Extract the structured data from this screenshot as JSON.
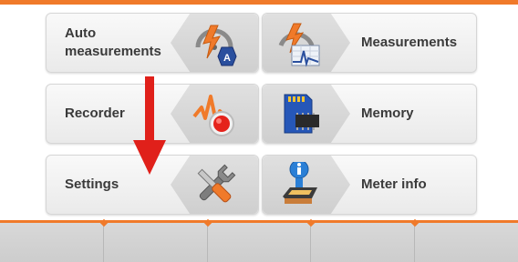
{
  "colors": {
    "accent": "#f07a2a",
    "arrow": "#e0201a"
  },
  "menu": {
    "auto_measurements": {
      "label_line1": "Auto",
      "label_line2": "measurements",
      "icon": "auto-measurements-icon"
    },
    "measurements": {
      "label": "Measurements",
      "icon": "measurements-icon"
    },
    "recorder": {
      "label": "Recorder",
      "icon": "recorder-icon"
    },
    "memory": {
      "label": "Memory",
      "icon": "memory-card-icon"
    },
    "settings": {
      "label": "Settings",
      "icon": "settings-tools-icon"
    },
    "meter_info": {
      "label": "Meter info",
      "icon": "meter-info-icon"
    }
  },
  "softkeys": [
    "",
    "",
    "",
    "",
    ""
  ]
}
